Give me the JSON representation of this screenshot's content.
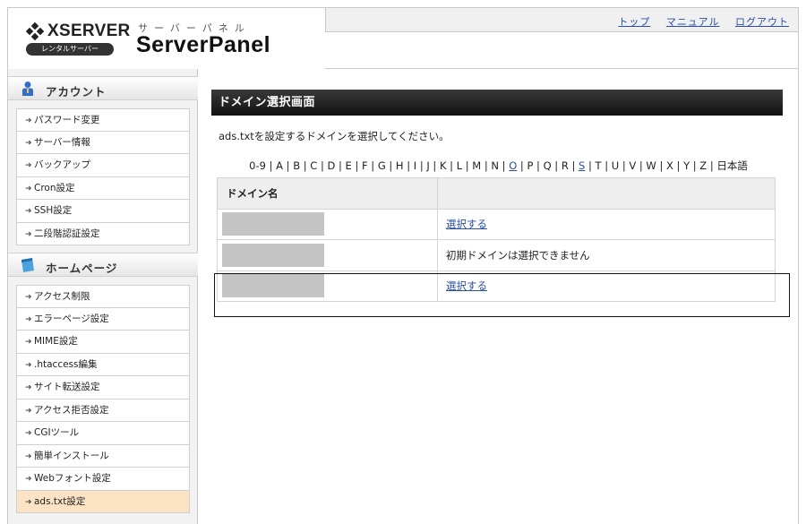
{
  "header": {
    "brand": "XSERVER",
    "brand_sub": "レンタルサーバー",
    "panel_kana": "サーバーパネル",
    "panel_name": "ServerPanel",
    "nav": [
      "トップ",
      "マニュアル",
      "ログアウト"
    ]
  },
  "sidebar": {
    "sections": [
      {
        "title": "アカウント",
        "icon": "account-person-icon",
        "items": [
          "パスワード変更",
          "サーバー情報",
          "バックアップ",
          "Cron設定",
          "SSH設定",
          "二段階認証設定"
        ]
      },
      {
        "title": "ホームページ",
        "icon": "homepage-folder-icon",
        "items": [
          "アクセス制限",
          "エラーページ設定",
          "MIME設定",
          ".htaccess編集",
          "サイト転送設定",
          "アクセス拒否設定",
          "CGIツール",
          "簡単インストール",
          "Webフォント設定",
          "ads.txt設定"
        ],
        "active": "ads.txt設定"
      }
    ]
  },
  "main": {
    "title": "ドメイン選択画面",
    "description": "ads.txtを設定するドメインを選択してください。",
    "alpha_filter": [
      "0-9",
      "A",
      "B",
      "C",
      "D",
      "E",
      "F",
      "G",
      "H",
      "I",
      "J",
      "K",
      "L",
      "M",
      "N",
      "O",
      "P",
      "Q",
      "R",
      "S",
      "T",
      "U",
      "V",
      "W",
      "X",
      "Y",
      "Z",
      "日本語"
    ],
    "alpha_linked": [
      "O",
      "S"
    ],
    "table": {
      "headers": [
        "ドメイン名",
        ""
      ],
      "rows": [
        {
          "domain": "",
          "action": "選択する",
          "action_is_link": true
        },
        {
          "domain": "",
          "action": "初期ドメインは選択できません",
          "action_is_link": false
        },
        {
          "domain": "",
          "action": "選択する",
          "action_is_link": true
        }
      ]
    }
  },
  "colors": {
    "link": "#2a4fa8",
    "active_item_bg": "#fbe3c4",
    "title_bar": "#1a1a1a",
    "redaction": "#c4c4c4"
  }
}
